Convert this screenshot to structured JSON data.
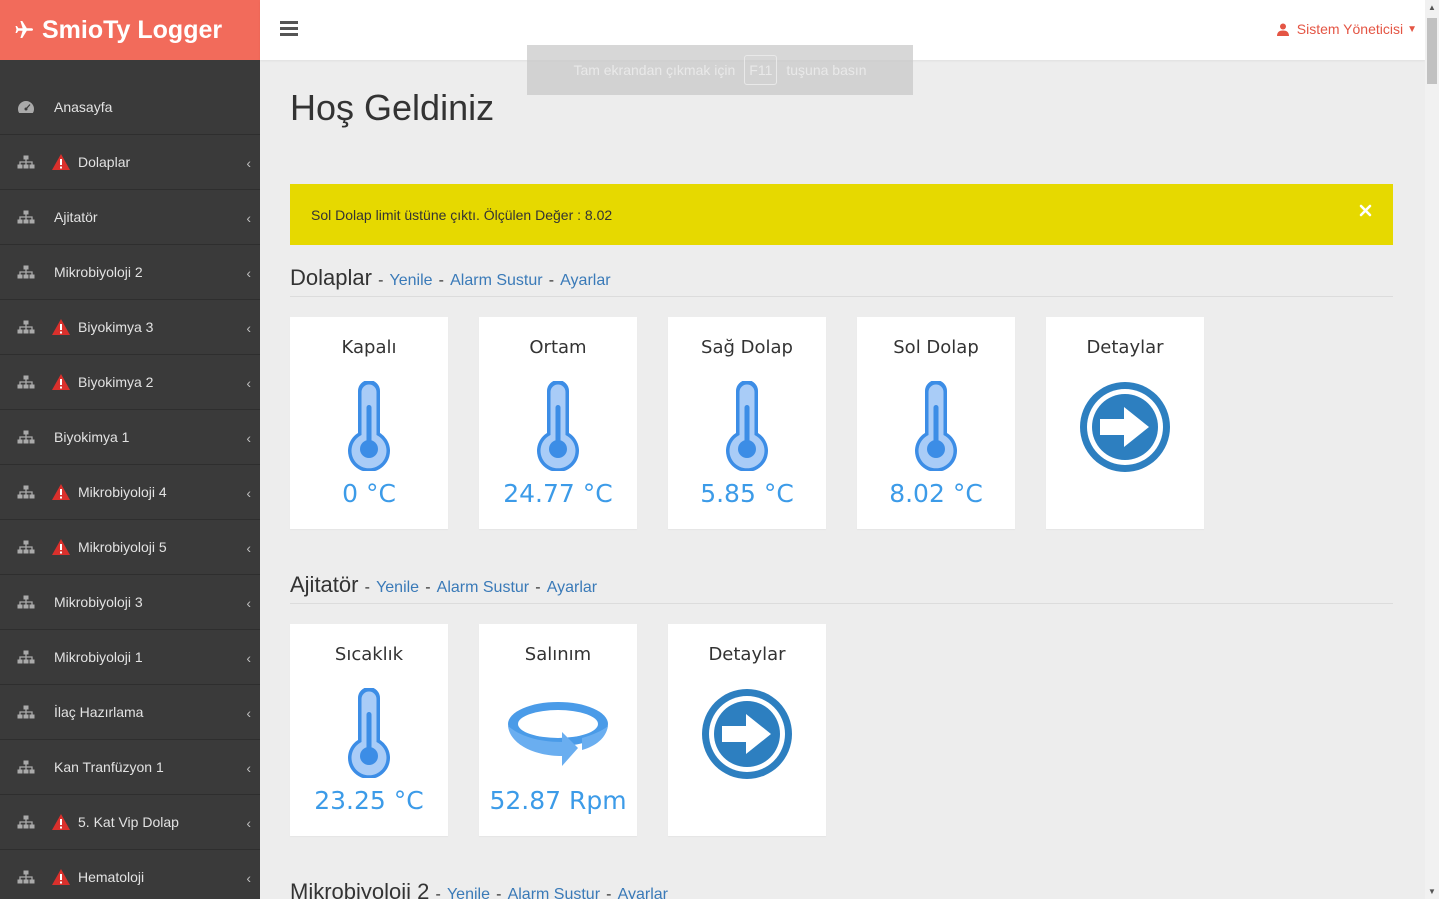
{
  "app": {
    "name": "SmioTy Logger"
  },
  "header": {
    "user": "Sistem Yöneticisi"
  },
  "fullscreen_notice": {
    "before": "Tam ekrandan çıkmak için",
    "key": "F11",
    "after": "tuşuna basın"
  },
  "sidebar": {
    "items": [
      {
        "label": "Anasayfa",
        "warn": false,
        "chevron": false,
        "icon": "dashboard-icon"
      },
      {
        "label": "Dolaplar",
        "warn": true,
        "chevron": true,
        "icon": "sitemap-icon"
      },
      {
        "label": "Ajitatör",
        "warn": false,
        "chevron": true,
        "icon": "sitemap-icon"
      },
      {
        "label": "Mikrobiyoloji 2",
        "warn": false,
        "chevron": true,
        "icon": "sitemap-icon"
      },
      {
        "label": "Biyokimya 3",
        "warn": true,
        "chevron": true,
        "icon": "sitemap-icon"
      },
      {
        "label": "Biyokimya 2",
        "warn": true,
        "chevron": true,
        "icon": "sitemap-icon"
      },
      {
        "label": "Biyokimya 1",
        "warn": false,
        "chevron": true,
        "icon": "sitemap-icon"
      },
      {
        "label": "Mikrobiyoloji 4",
        "warn": true,
        "chevron": true,
        "icon": "sitemap-icon"
      },
      {
        "label": "Mikrobiyoloji 5",
        "warn": true,
        "chevron": true,
        "icon": "sitemap-icon"
      },
      {
        "label": "Mikrobiyoloji 3",
        "warn": false,
        "chevron": true,
        "icon": "sitemap-icon"
      },
      {
        "label": "Mikrobiyoloji 1",
        "warn": false,
        "chevron": true,
        "icon": "sitemap-icon"
      },
      {
        "label": "İlaç Hazırlama",
        "warn": false,
        "chevron": true,
        "icon": "sitemap-icon"
      },
      {
        "label": "Kan Tranfüzyon 1",
        "warn": false,
        "chevron": true,
        "icon": "sitemap-icon"
      },
      {
        "label": "5. Kat Vip Dolap",
        "warn": true,
        "chevron": true,
        "icon": "sitemap-icon"
      },
      {
        "label": "Hematoloji",
        "warn": true,
        "chevron": true,
        "icon": "sitemap-icon"
      }
    ]
  },
  "main": {
    "title": "Hoş Geldiniz",
    "alert": "Sol Dolap limit üstüne çıktı. Ölçülen Değer : 8.02",
    "links": {
      "refresh": "Yenile",
      "silence": "Alarm Sustur",
      "settings": "Ayarlar",
      "sep": "-"
    },
    "sections": [
      {
        "name": "Dolaplar",
        "cards": [
          {
            "title": "Kapalı",
            "value": "0 °C",
            "icon": "thermometer-icon"
          },
          {
            "title": "Ortam",
            "value": "24.77 °C",
            "icon": "thermometer-icon"
          },
          {
            "title": "Sağ Dolap",
            "value": "5.85 °C",
            "icon": "thermometer-icon"
          },
          {
            "title": "Sol Dolap",
            "value": "8.02 °C",
            "icon": "thermometer-icon"
          },
          {
            "title": "Detaylar",
            "value": "",
            "icon": "arrow-right-circle-icon"
          }
        ]
      },
      {
        "name": "Ajitatör",
        "cards": [
          {
            "title": "Sıcaklık",
            "value": "23.25 °C",
            "icon": "thermometer-icon"
          },
          {
            "title": "Salınım",
            "value": "52.87 Rpm",
            "icon": "rotate-icon"
          },
          {
            "title": "Detaylar",
            "value": "",
            "icon": "arrow-right-circle-icon"
          }
        ]
      },
      {
        "name": "Mikrobiyoloji 2",
        "cards": []
      }
    ]
  },
  "colors": {
    "brand": "#f26b5b",
    "sidebar": "#3a3a3a",
    "accent": "#3c9be8",
    "alert": "#e6d900",
    "link": "#3a7ab8"
  }
}
